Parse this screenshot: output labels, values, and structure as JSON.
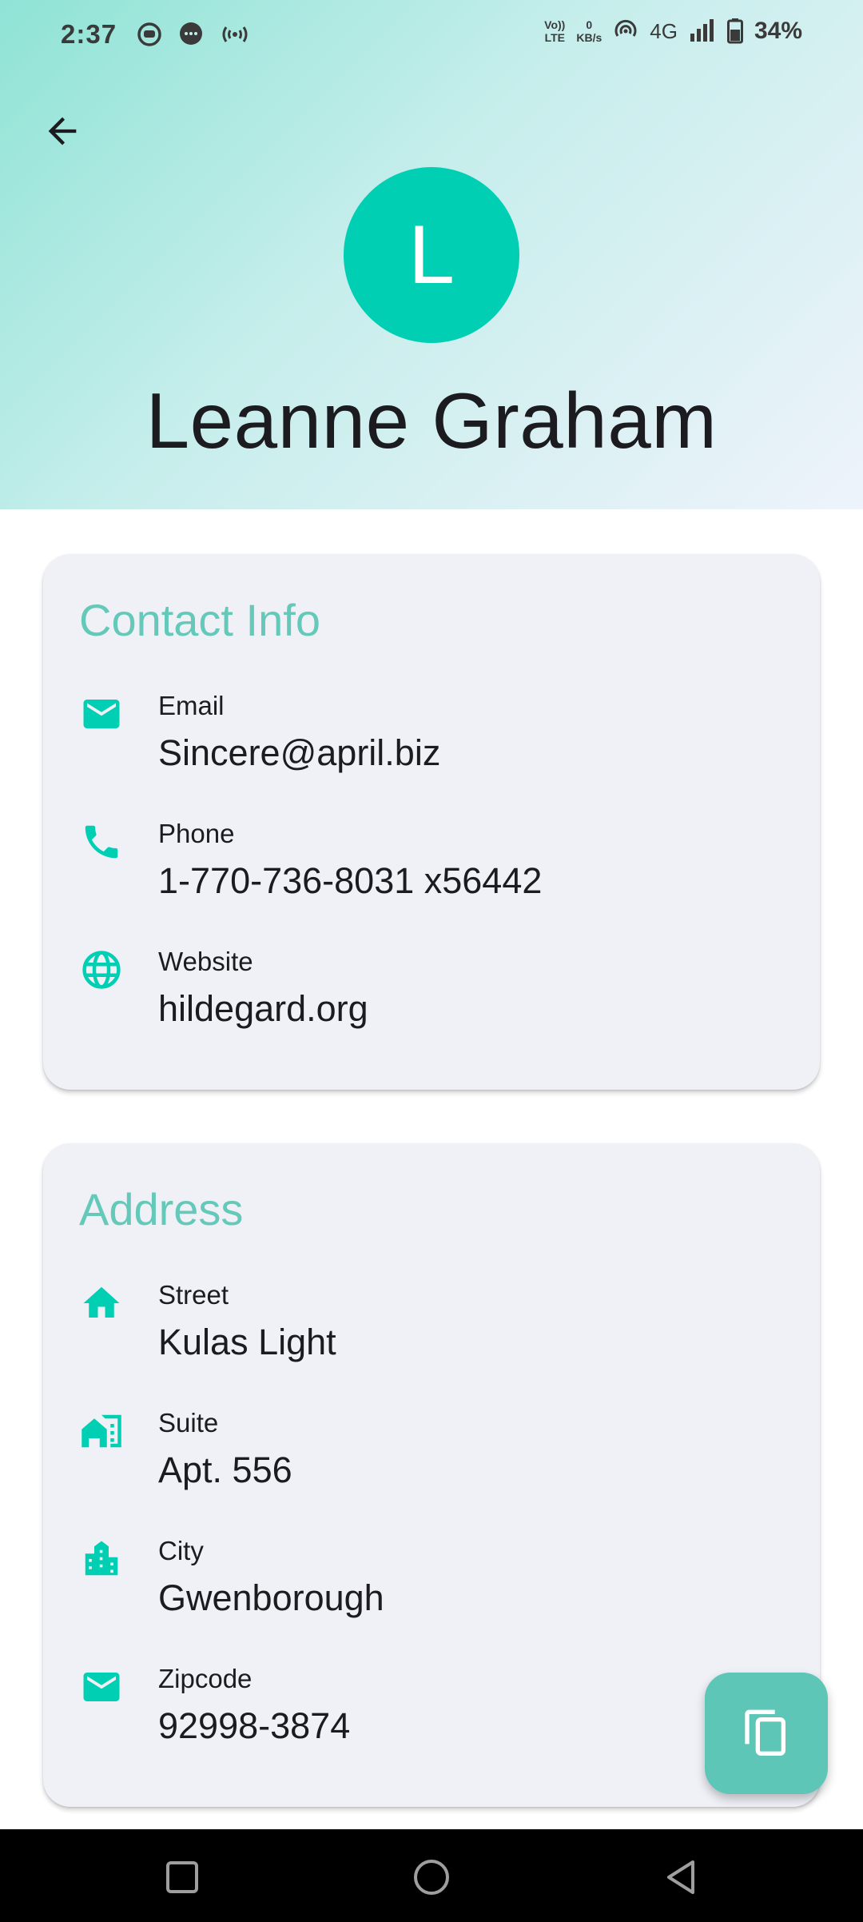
{
  "status_bar": {
    "time": "2:37",
    "volte_top": "Vo))",
    "volte_bottom": "LTE",
    "speed_value": "0",
    "speed_unit": "KB/s",
    "network": "4G",
    "battery": "34%"
  },
  "header": {
    "avatar_letter": "L",
    "name": "Leanne Graham"
  },
  "contact": {
    "title": "Contact Info",
    "email_label": "Email",
    "email_value": "Sincere@april.biz",
    "phone_label": "Phone",
    "phone_value": "1-770-736-8031 x56442",
    "website_label": "Website",
    "website_value": "hildegard.org"
  },
  "address": {
    "title": "Address",
    "street_label": "Street",
    "street_value": "Kulas Light",
    "suite_label": "Suite",
    "suite_value": "Apt. 556",
    "city_label": "City",
    "city_value": "Gwenborough",
    "zipcode_label": "Zipcode",
    "zipcode_value": "92998-3874"
  },
  "icons": {
    "back": "arrow-back-icon",
    "email": "mail-icon",
    "phone": "phone-icon",
    "website": "globe-icon",
    "street": "home-icon",
    "suite": "apartment-icon",
    "city": "city-icon",
    "zipcode": "mail-icon",
    "fab": "copy-icon"
  },
  "colors": {
    "accent": "#00cfb3",
    "section_title": "#64c9b9",
    "card_background": "#f0f1f7",
    "fab_background": "#5ec6b6"
  }
}
